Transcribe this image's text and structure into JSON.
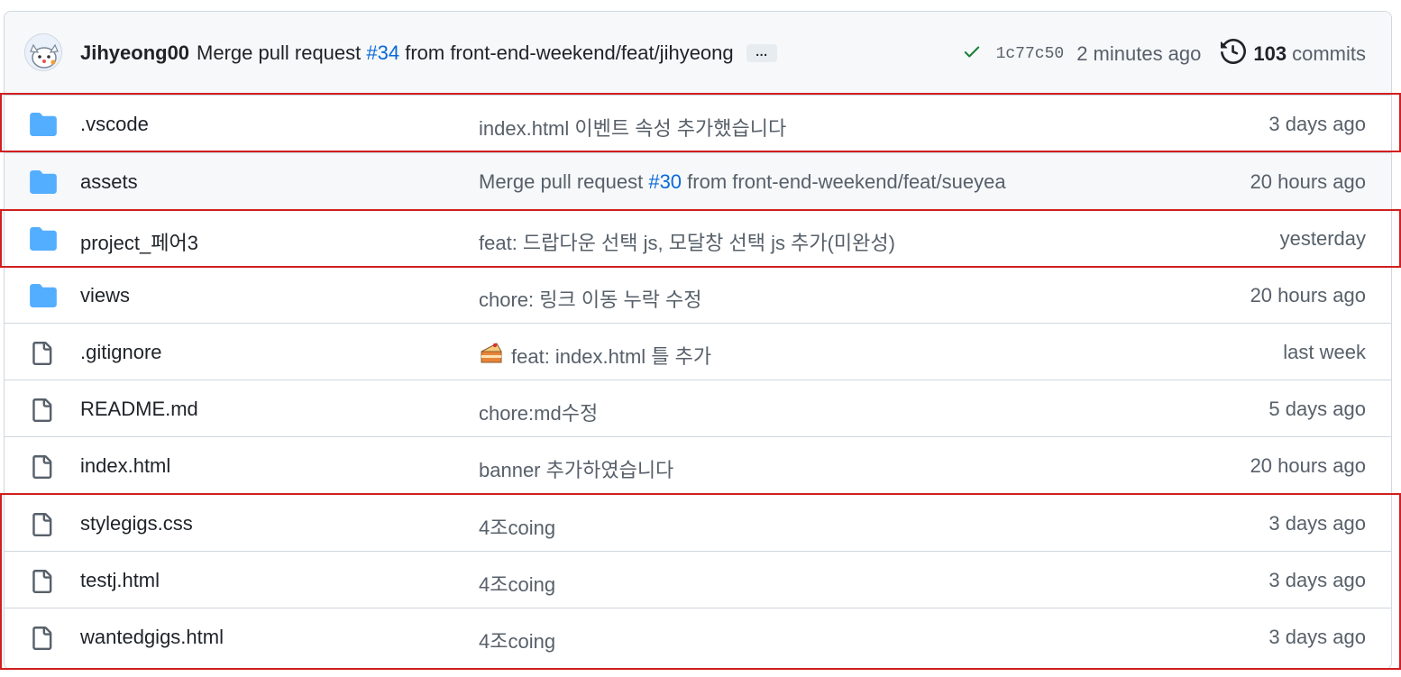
{
  "commit_header": {
    "author": "Jihyeong00",
    "message_prefix": "Merge pull request ",
    "pr_link": "#34",
    "message_suffix": " from front-end-weekend/feat/jihyeong",
    "ellipsis": "…",
    "sha": "1c77c50",
    "time": "2 minutes ago",
    "commits_count": "103",
    "commits_label": "commits",
    "status": "success"
  },
  "files": [
    {
      "type": "folder",
      "name": ".vscode",
      "message": "index.html 이벤트 속성 추가했습니다",
      "time": "3 days ago",
      "highlighted": true
    },
    {
      "type": "folder",
      "name": "assets",
      "message_prefix": "Merge pull request ",
      "message_link": "#30",
      "message_suffix": " from front-end-weekend/feat/sueyea",
      "time": "20 hours ago",
      "highlighted": false
    },
    {
      "type": "folder",
      "name": "project_페어3",
      "message": "feat: 드랍다운 선택 js, 모달창 선택 js 추가(미완성)",
      "time": "yesterday",
      "highlighted": true
    },
    {
      "type": "folder",
      "name": "views",
      "message": "chore: 링크 이동 누락 수정",
      "time": "20 hours ago",
      "highlighted": false
    },
    {
      "type": "file",
      "name": ".gitignore",
      "emoji": "cake-emoji-icon",
      "message": "feat: index.html 틀 추가",
      "time": "last week",
      "highlighted": false
    },
    {
      "type": "file",
      "name": "README.md",
      "message": "chore:md수정",
      "time": "5 days ago",
      "highlighted": false
    },
    {
      "type": "file",
      "name": "index.html",
      "message": "banner 추가하였습니다",
      "time": "20 hours ago",
      "highlighted": false
    },
    {
      "type": "file",
      "name": "stylegigs.css",
      "message": "4조coing",
      "time": "3 days ago",
      "highlighted": true
    },
    {
      "type": "file",
      "name": "testj.html",
      "message": "4조coing",
      "time": "3 days ago",
      "highlighted": true
    },
    {
      "type": "file",
      "name": "wantedgigs.html",
      "message": "4조coing",
      "time": "3 days ago",
      "highlighted": true
    }
  ],
  "colors": {
    "folder": "#54aeff",
    "file_icon": "#57606a",
    "link": "#0969da",
    "highlight_box": "#d11f1f",
    "check": "#1a7f37"
  }
}
